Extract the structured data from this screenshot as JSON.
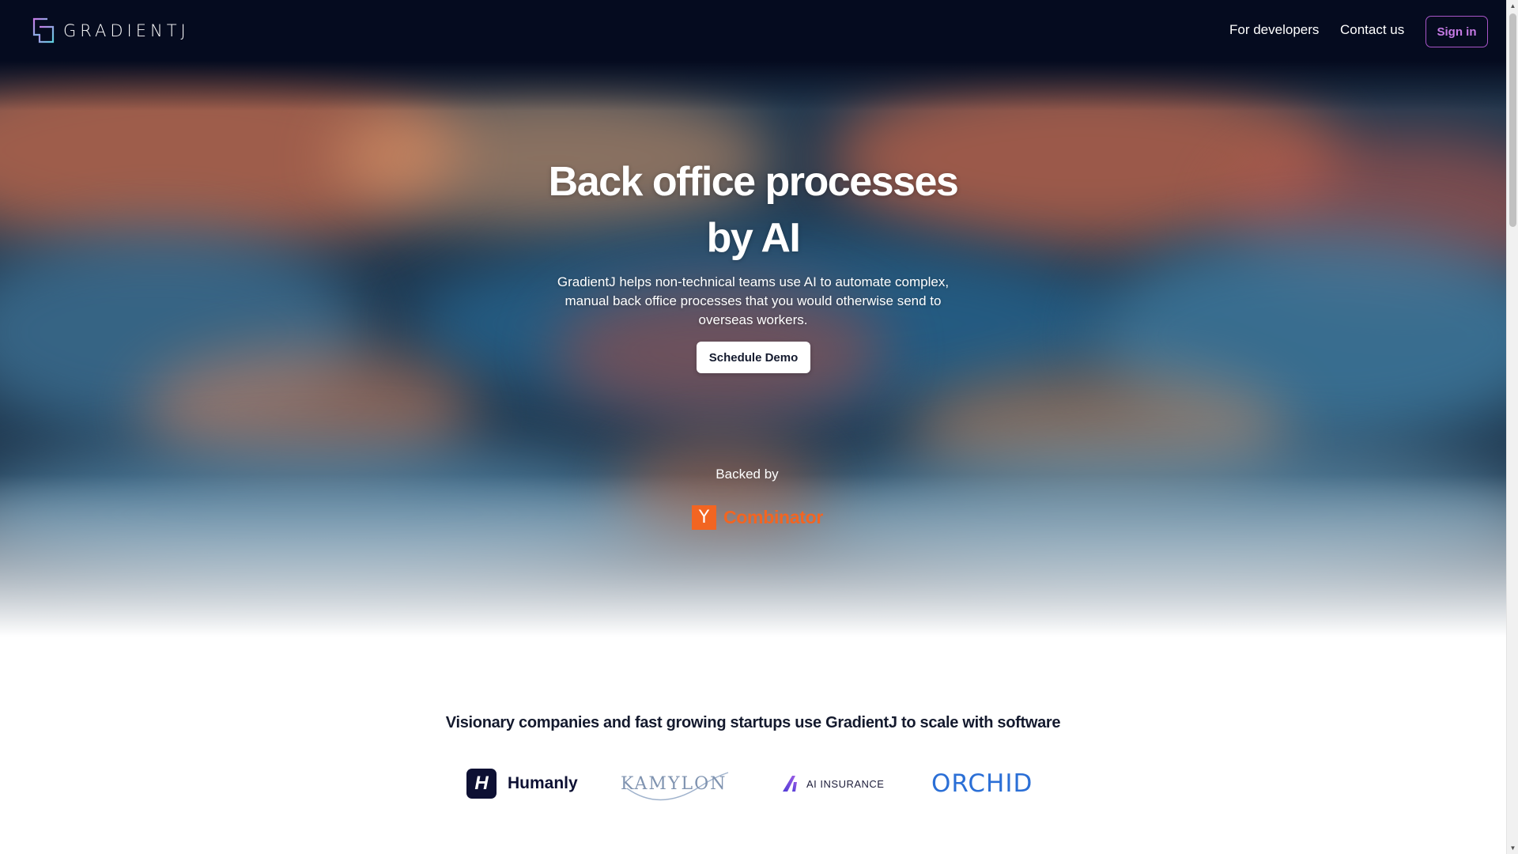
{
  "nav": {
    "logo_text": "GRADIENTJ",
    "links": [
      "For developers",
      "Contact us"
    ],
    "signin_label": "Sign in"
  },
  "hero": {
    "title_line1": "Back office processes",
    "title_line2": "by AI",
    "subtitle": "GradientJ helps non-technical teams use AI to automate complex, manual back office processes that you would otherwise send to overseas workers.",
    "cta_label": "Schedule Demo",
    "backed_by": "Backed by",
    "backer": {
      "mark": "Y",
      "name": "Combinator",
      "color": "#f26522"
    }
  },
  "customers": {
    "heading": "Visionary companies and fast growing startups use GradientJ to scale with software",
    "logos": [
      {
        "name": "Humanly",
        "mark": "H"
      },
      {
        "name": "KAMYLON"
      },
      {
        "name": "AI INSURANCE"
      },
      {
        "name": "ORCHID"
      }
    ]
  },
  "colors": {
    "nav_bg": "#050b1f",
    "accent_purple": "#a855c8",
    "text_dark": "#141a2e"
  }
}
